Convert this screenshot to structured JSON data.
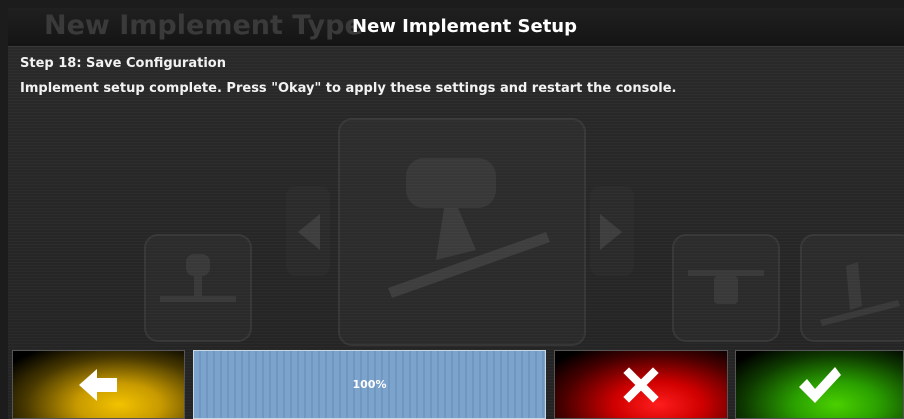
{
  "header": {
    "background_title": "New Implement Type",
    "title": "New Implement Setup"
  },
  "content": {
    "step_title": "Step 18: Save Configuration",
    "message": "Implement setup complete. Press \"Okay\" to apply these settings and restart the console."
  },
  "footer": {
    "back_icon": "arrow-left-icon",
    "progress": {
      "label": "100%",
      "value": 1.0
    },
    "cancel_icon": "x-icon",
    "ok_icon": "checkmark-icon"
  },
  "colors": {
    "back": "#f2c200",
    "cancel": "#ff1d1d",
    "ok": "#4ad000",
    "progress": "#7ba3cc"
  }
}
